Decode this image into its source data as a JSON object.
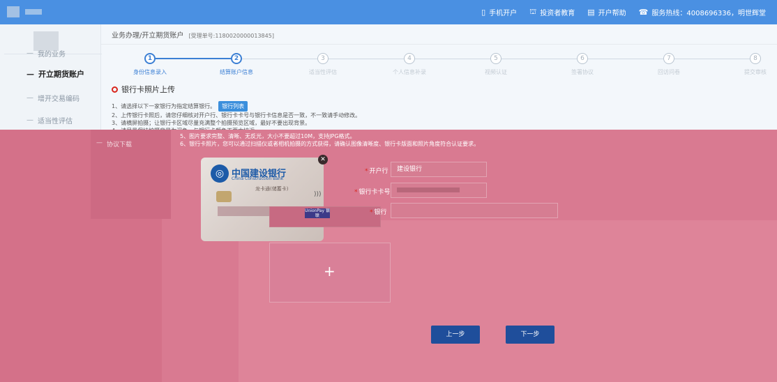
{
  "header": {
    "nav": [
      {
        "icon": "mobile-icon",
        "glyph": "▯",
        "label": "手机开户"
      },
      {
        "icon": "education-icon",
        "glyph": "⛫",
        "label": "投资者教育"
      },
      {
        "icon": "help-icon",
        "glyph": "▤",
        "label": "开户帮助"
      },
      {
        "icon": "phone-icon",
        "glyph": "☎",
        "label": "服务热线：4008696336，明世辉堂"
      }
    ]
  },
  "sidebar": {
    "items": [
      {
        "label": "我的业务",
        "active": false
      },
      {
        "label": "开立期货账户",
        "active": true
      },
      {
        "label": "增开交易编码",
        "active": false
      },
      {
        "label": "适当性评估",
        "active": false
      },
      {
        "label": "协议下载",
        "active": false
      }
    ]
  },
  "breadcrumb": {
    "path": "业务办理/开立期货账户",
    "order": "[受理单号:1180020000013845]"
  },
  "stepper": {
    "current": 2,
    "steps": [
      {
        "num": "1",
        "label": "身份信息录入"
      },
      {
        "num": "2",
        "label": "结算账户信息"
      },
      {
        "num": "3",
        "label": "适当性评估"
      },
      {
        "num": "4",
        "label": "个人信息补录"
      },
      {
        "num": "5",
        "label": "视频认证"
      },
      {
        "num": "6",
        "label": "签署协议"
      },
      {
        "num": "7",
        "label": "回访问卷"
      },
      {
        "num": "8",
        "label": "提交审核"
      }
    ]
  },
  "upload": {
    "title": "银行卡照片上传",
    "bank_list_button": "银行列表",
    "notes": [
      "1、请选择以下一家银行为指定结算银行。",
      "2、上传银行卡照后，请您仔细核对开户行、银行卡卡号与银行卡信息是否一致，不一致请手动修改。",
      "3、请横屏拍摄；让银行卡区域尽量充满整个拍摄预览区域，最好不要出现背景。",
      "4、请尽量保持拍摄背景为深色，与银行卡颜色不要太接近。",
      "5、图片要求完整、清晰、无反光，大小不要超过10M，支持JPG格式。",
      "6、银行卡照片，您可以通过扫描仪或者相机拍摄的方式获得，请确认图像清晰度、银行卡版面和照片角度符合认证要求。"
    ]
  },
  "card_image": {
    "bank_name": "中国建设银行",
    "bank_en": "China Construction Bank",
    "card_type": "龙卡通(储蓄卡)",
    "logo_text": "UnionPay 银联"
  },
  "form": {
    "bank_label": "开户行",
    "bank_value": "建设银行",
    "card_no_label": "银行卡卡号",
    "third_label": "银行"
  },
  "buttons": {
    "prev": "上一步",
    "next": "下一步"
  }
}
